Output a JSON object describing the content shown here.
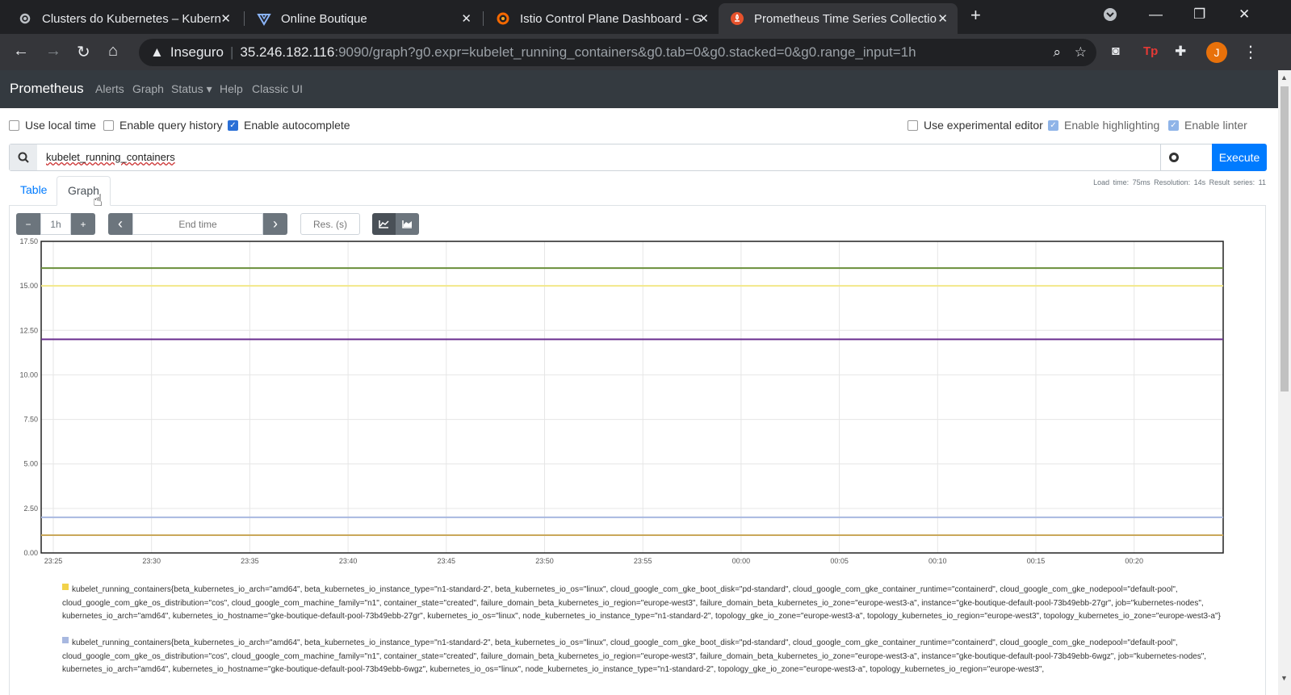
{
  "browser": {
    "tabs": [
      {
        "title": "Clusters do Kubernetes – Kubern",
        "active": false
      },
      {
        "title": "Online Boutique",
        "active": false
      },
      {
        "title": "Istio Control Plane Dashboard - G",
        "active": false
      },
      {
        "title": "Prometheus Time Series Collectio",
        "active": true
      }
    ],
    "insecure_label": "Inseguro",
    "url_host": "35.246.182.116",
    "url_rest": ":9090/graph?g0.expr=kubelet_running_containers&g0.tab=0&g0.stacked=0&g0.range_input=1h",
    "profile_initial": "J"
  },
  "nav": {
    "brand": "Prometheus",
    "items": [
      "Alerts",
      "Graph",
      "Status",
      "Help",
      "Classic UI"
    ]
  },
  "options": {
    "use_local_time": {
      "label": "Use local time",
      "checked": false
    },
    "query_history": {
      "label": "Enable query history",
      "checked": false
    },
    "autocomplete": {
      "label": "Enable autocomplete",
      "checked": true
    },
    "experimental_editor": {
      "label": "Use experimental editor",
      "checked": false
    },
    "highlighting": {
      "label": "Enable highlighting",
      "checked": true
    },
    "linter": {
      "label": "Enable linter",
      "checked": true
    }
  },
  "query": {
    "expression": "kubelet_running_containers",
    "execute_label": "Execute"
  },
  "stats": {
    "text": "Load time: 75ms   Resolution: 14s   Result series: 11"
  },
  "tabs": {
    "table": "Table",
    "graph": "Graph"
  },
  "controls": {
    "minus": "−",
    "range": "1h",
    "plus": "+",
    "prev": "‹",
    "end_time_placeholder": "End time",
    "next": "›",
    "resolution_placeholder": "Res. (s)"
  },
  "chart_data": {
    "type": "line",
    "x": [
      "23:25",
      "23:30",
      "23:35",
      "23:40",
      "23:45",
      "23:50",
      "23:55",
      "00:00",
      "00:05",
      "00:10",
      "00:15",
      "00:20"
    ],
    "ylim": [
      0,
      17.5
    ],
    "yticks": [
      "0.00",
      "2.50",
      "5.00",
      "7.50",
      "10.00",
      "12.50",
      "15.00",
      "17.50"
    ],
    "grid": true,
    "series": [
      {
        "color": "#6a8f3a",
        "values": [
          16,
          16,
          16,
          16,
          16,
          16,
          16,
          16,
          16,
          16,
          16,
          16
        ]
      },
      {
        "color": "#f2e88a",
        "values": [
          15,
          15,
          15,
          15,
          15,
          15,
          15,
          15,
          15,
          15,
          15,
          15
        ]
      },
      {
        "color": "#6a2f8f",
        "values": [
          12,
          12,
          12,
          12,
          12,
          12,
          12,
          12,
          12,
          12,
          12,
          12
        ]
      },
      {
        "color": "#a8b8e0",
        "values": [
          2,
          2,
          2,
          2,
          2,
          2,
          2,
          2,
          2,
          2,
          2,
          2
        ]
      },
      {
        "color": "#c9a85a",
        "values": [
          1,
          1,
          1,
          1,
          1,
          1,
          1,
          1,
          1,
          1,
          1,
          1
        ]
      }
    ]
  },
  "legend": [
    {
      "color": "#f2d24a",
      "metric": "kubelet_running_containers",
      "labels": "beta_kubernetes_io_arch=\"amd64\", beta_kubernetes_io_instance_type=\"n1-standard-2\", beta_kubernetes_io_os=\"linux\", cloud_google_com_gke_boot_disk=\"pd-standard\", cloud_google_com_gke_container_runtime=\"containerd\", cloud_google_com_gke_nodepool=\"default-pool\", cloud_google_com_gke_os_distribution=\"cos\", cloud_google_com_machine_family=\"n1\", container_state=\"created\", failure_domain_beta_kubernetes_io_region=\"europe-west3\", failure_domain_beta_kubernetes_io_zone=\"europe-west3-a\", instance=\"gke-boutique-default-pool-73b49ebb-27gr\", job=\"kubernetes-nodes\", kubernetes_io_arch=\"amd64\", kubernetes_io_hostname=\"gke-boutique-default-pool-73b49ebb-27gr\", kubernetes_io_os=\"linux\", node_kubernetes_io_instance_type=\"n1-standard-2\", topology_gke_io_zone=\"europe-west3-a\", topology_kubernetes_io_region=\"europe-west3\", topology_kubernetes_io_zone=\"europe-west3-a\"}"
    },
    {
      "color": "#a8b8e0",
      "metric": "kubelet_running_containers",
      "labels": "beta_kubernetes_io_arch=\"amd64\", beta_kubernetes_io_instance_type=\"n1-standard-2\", beta_kubernetes_io_os=\"linux\", cloud_google_com_gke_boot_disk=\"pd-standard\", cloud_google_com_gke_container_runtime=\"containerd\", cloud_google_com_gke_nodepool=\"default-pool\", cloud_google_com_gke_os_distribution=\"cos\", cloud_google_com_machine_family=\"n1\", container_state=\"created\", failure_domain_beta_kubernetes_io_region=\"europe-west3\", failure_domain_beta_kubernetes_io_zone=\"europe-west3-a\", instance=\"gke-boutique-default-pool-73b49ebb-6wgz\", job=\"kubernetes-nodes\", kubernetes_io_arch=\"amd64\", kubernetes_io_hostname=\"gke-boutique-default-pool-73b49ebb-6wgz\", kubernetes_io_os=\"linux\", node_kubernetes_io_instance_type=\"n1-standard-2\", topology_gke_io_zone=\"europe-west3-a\", topology_kubernetes_io_region=\"europe-west3\","
    }
  ]
}
